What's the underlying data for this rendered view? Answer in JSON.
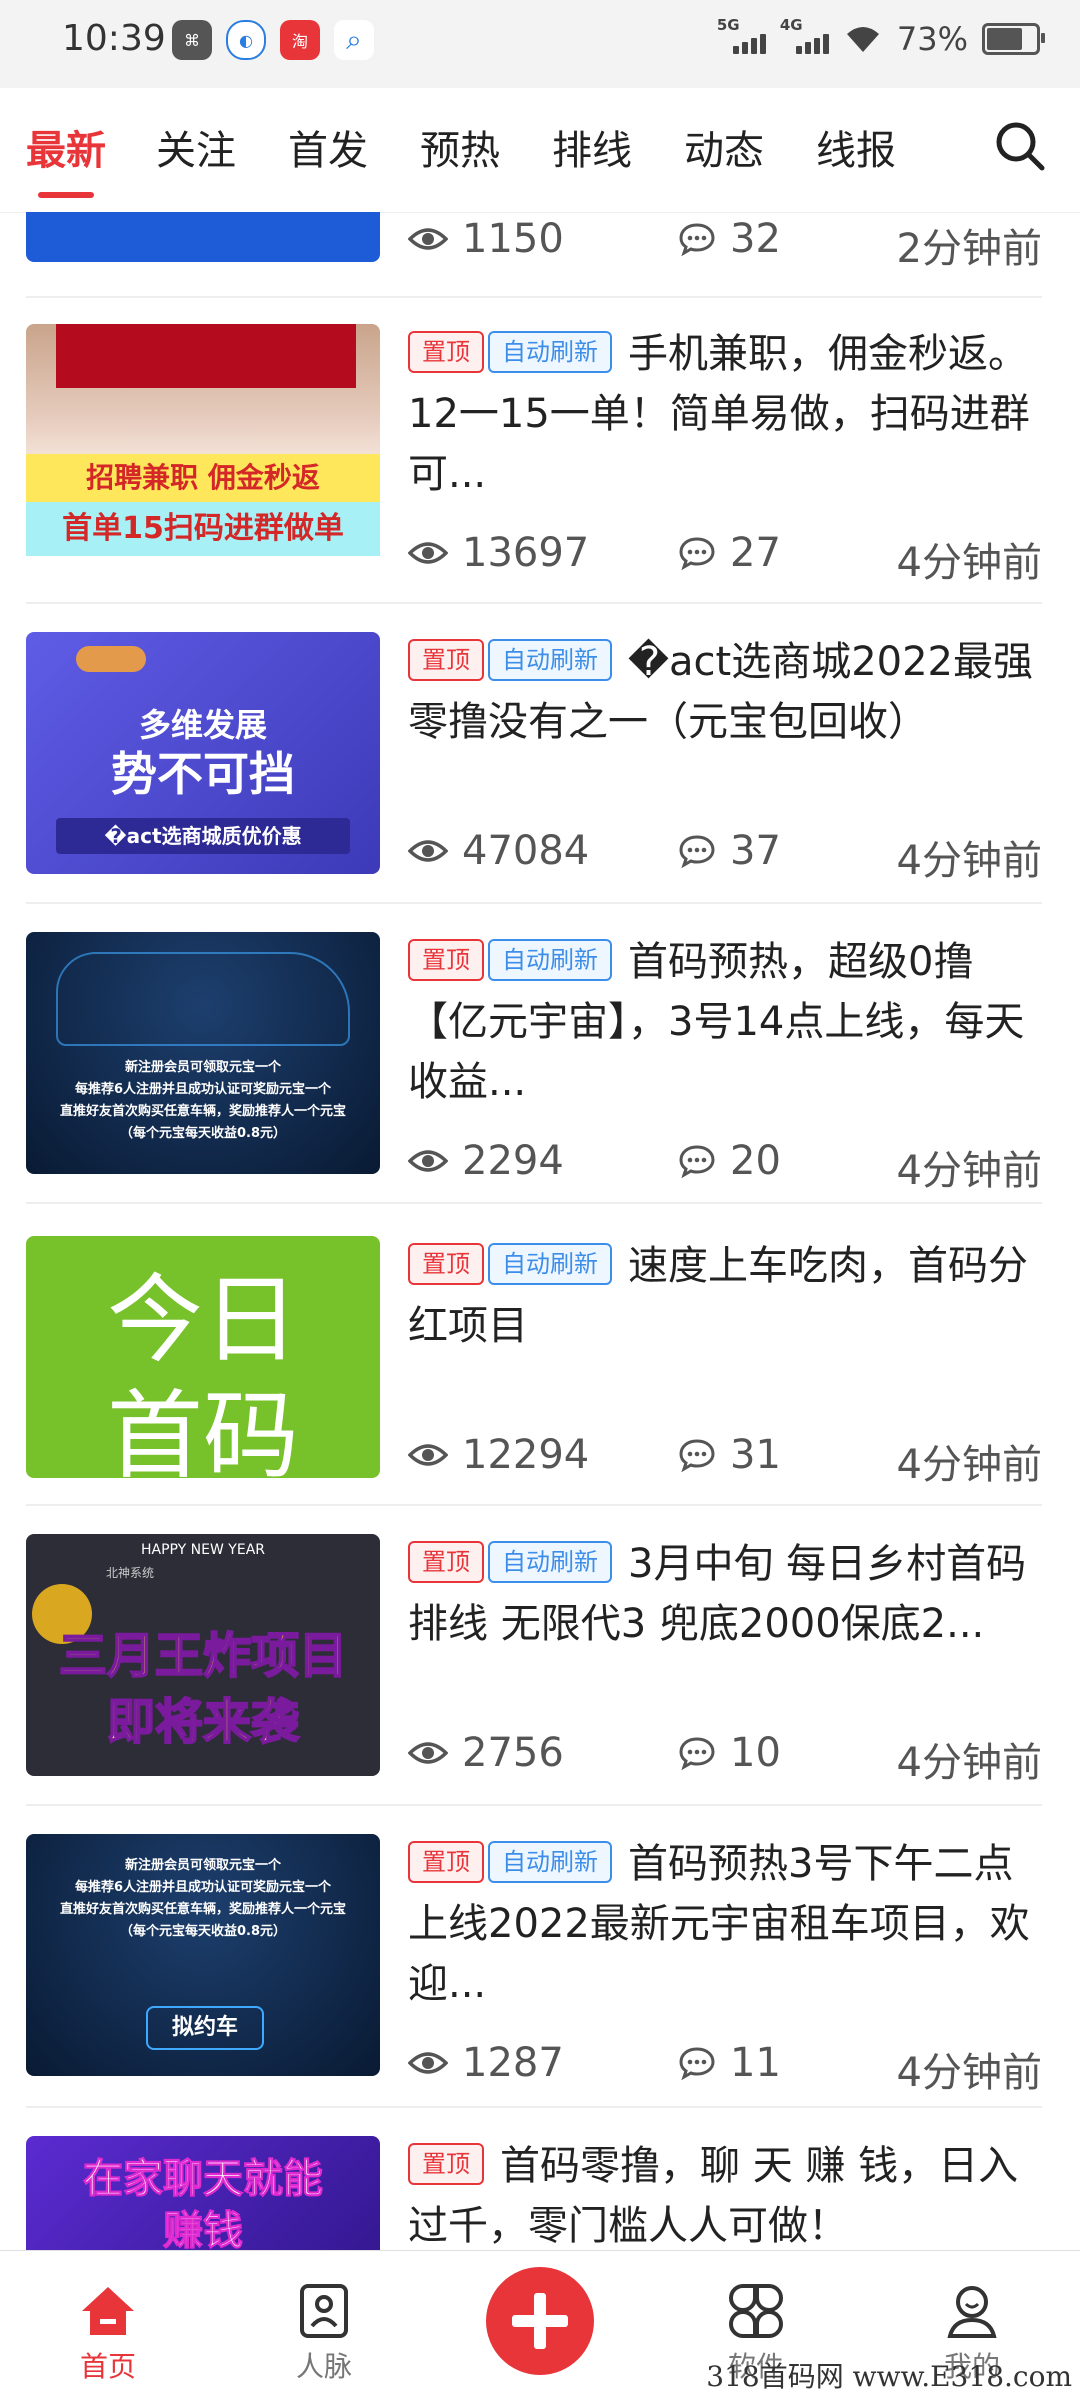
{
  "status_bar": {
    "time": "10:39",
    "net1": "5G",
    "net2": "4G",
    "battery": "73%"
  },
  "tabs": [
    {
      "label": "最新",
      "active": true
    },
    {
      "label": "关注"
    },
    {
      "label": "首发"
    },
    {
      "label": "预热"
    },
    {
      "label": "排线"
    },
    {
      "label": "动态"
    },
    {
      "label": "线报"
    }
  ],
  "badges": {
    "top": "置顶",
    "auto": "自动刷新"
  },
  "partial_item": {
    "views": "1150",
    "comments": "32",
    "time": "2分钟前"
  },
  "items": [
    {
      "title": "手机兼职，佣金秒返。12一15一单！简单易做，扫码进群可...",
      "views": "13697",
      "comments": "27",
      "time": "4分钟前",
      "thumb_text": [
        "招聘兼职  佣金秒返",
        "首单15扫码进群做单"
      ]
    },
    {
      "title": "�act选商城2022最强零撸没有之一（元宝包回收）",
      "views": "47084",
      "comments": "37",
      "time": "4分钟前",
      "thumb_text": [
        "多维发展",
        "势不可挡",
        "�act选商城质优价惠"
      ]
    },
    {
      "title": "首码预热，超级0撸【亿元宇宙】，3号14点上线，每天收益...",
      "views": "2294",
      "comments": "20",
      "time": "4分钟前",
      "thumb_text": [
        "新注册会员可领取元宝一个",
        "每推荐6人注册并且成功认证可奖励元宝一个",
        "直推好友首次购买任意车辆，奖励推荐人一个元宝",
        "（每个元宝每天收益0.8元）"
      ]
    },
    {
      "title": "速度上车吃肉，首码分红项目",
      "views": "12294",
      "comments": "31",
      "time": "4分钟前",
      "thumb_text": [
        "今日",
        "首码"
      ]
    },
    {
      "title": "3月中旬 每日乡村首码排线 无限代3 兜底2000保底2...",
      "views": "2756",
      "comments": "10",
      "time": "4分钟前",
      "thumb_text": [
        "HAPPY NEW YEAR",
        "北神系统",
        "三月王炸项目",
        "即将来袭"
      ]
    },
    {
      "title": "首码预热3号下午二点上线2022最新元宇宙租车项目，欢迎...",
      "views": "1287",
      "comments": "11",
      "time": "4分钟前",
      "thumb_text": [
        "新注册会员可领取元宝一个",
        "每推荐6人注册并且成功认证可奖励元宝一个",
        "直推好友首次购买任意车辆，奖励推荐人一个元宝",
        "（每个元宝每天收益0.8元）",
        "拟约车"
      ]
    },
    {
      "title": "首码零撸，聊 天 赚 钱，日入过千，零门槛人人可做！",
      "thumb_text": [
        "在家聊天就能",
        "赚钱"
      ]
    }
  ],
  "nav": [
    {
      "label": "首页",
      "icon": "home-icon"
    },
    {
      "label": "人脉",
      "icon": "contacts-icon"
    },
    {
      "label": "",
      "icon": "plus-icon"
    },
    {
      "label": "软件",
      "icon": "apps-icon"
    },
    {
      "label": "我的",
      "icon": "profile-icon"
    }
  ],
  "watermark": "318首码网 www.E318.com",
  "colors": {
    "accent": "#e8353a",
    "badge_blue": "#3d8ee8"
  }
}
